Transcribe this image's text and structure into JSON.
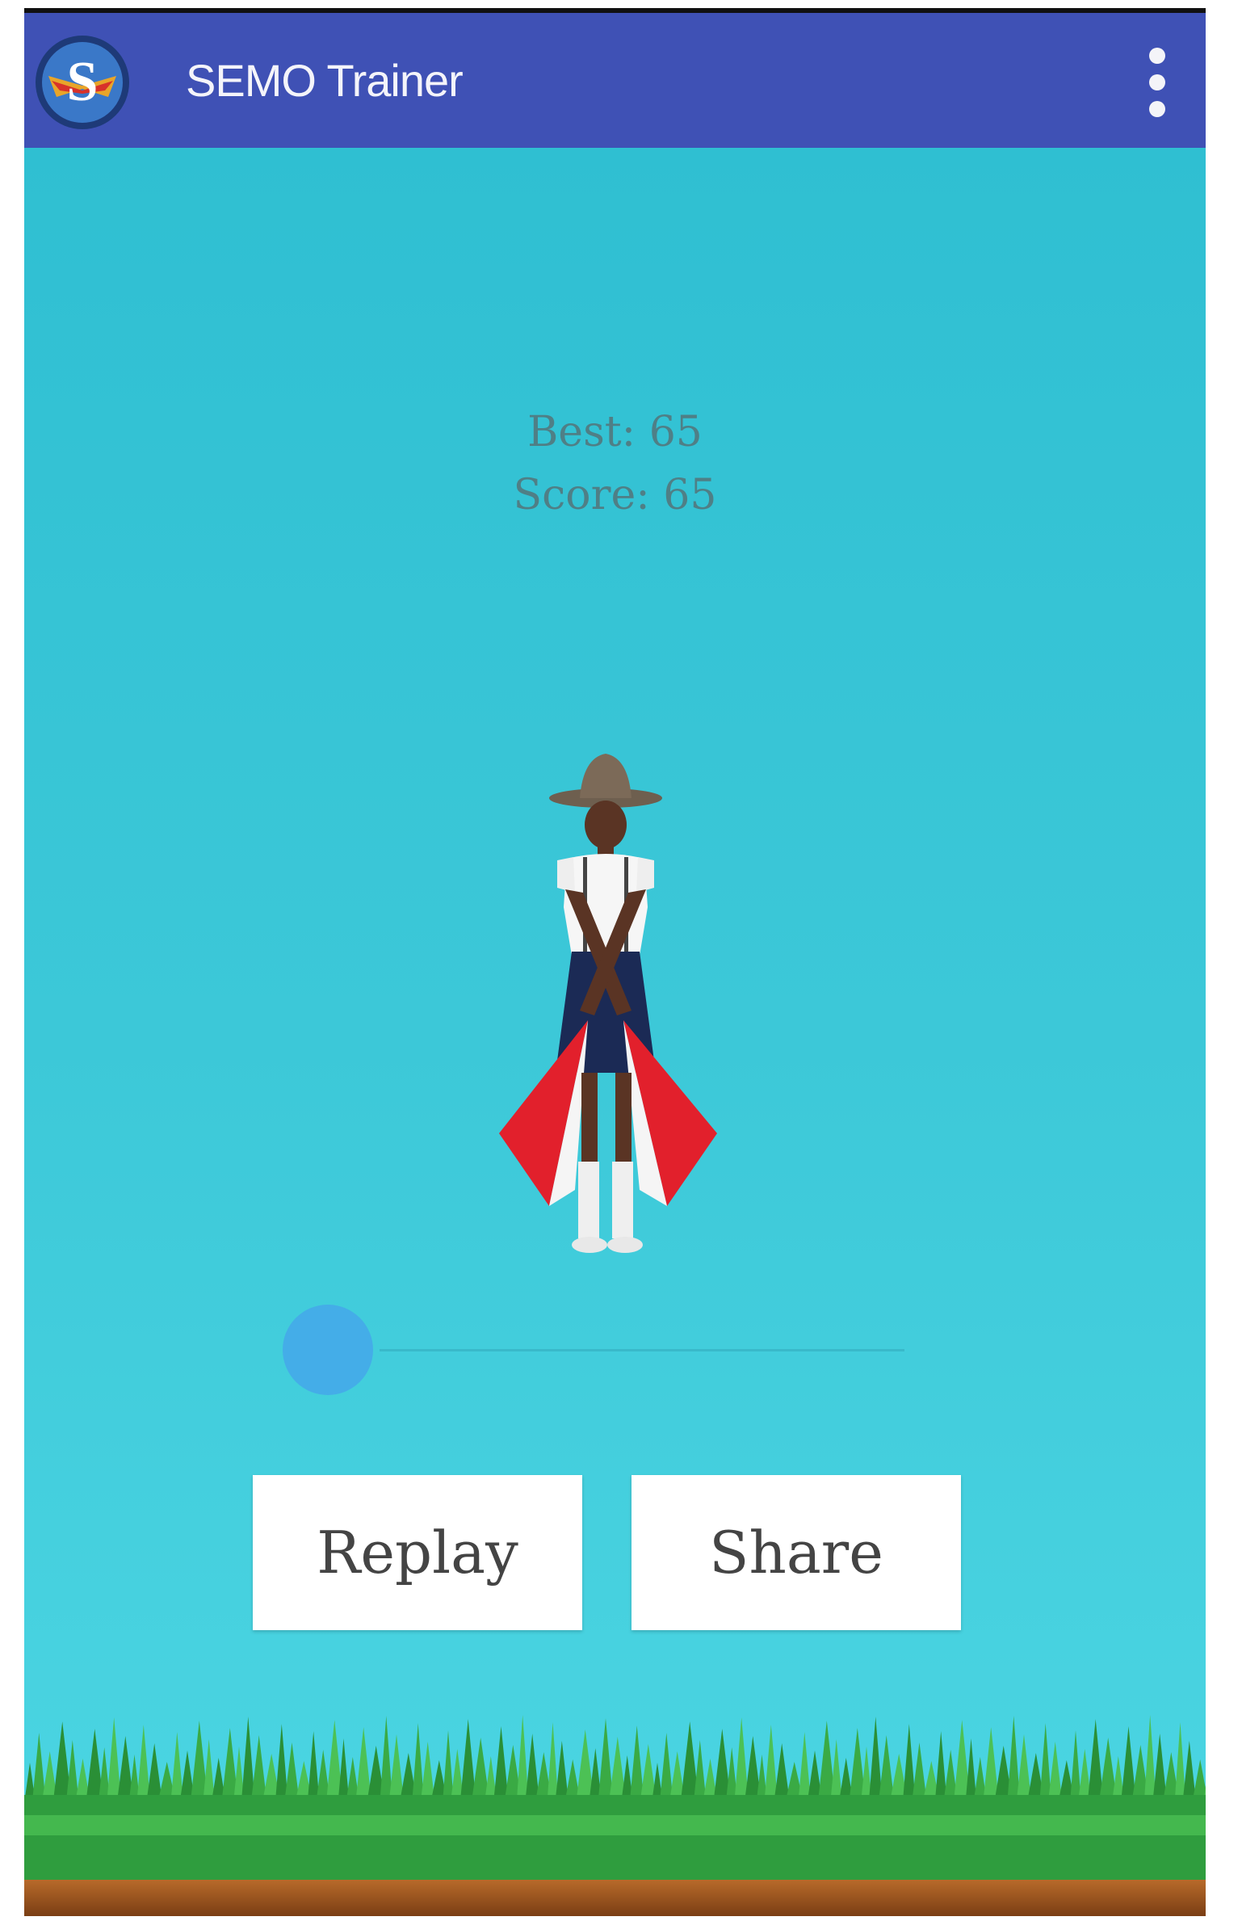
{
  "app_bar": {
    "title": "SEMO Trainer",
    "background_color": "#3f51b5",
    "logo_icon": "semo-logo-icon",
    "menu_icon": "overflow-menu-icon"
  },
  "game": {
    "background_color": "#3cc8d8",
    "best_text": "Best: 65",
    "score_text": "Score: 65",
    "best": 65,
    "score": 65,
    "character": "scout-with-semaphore-flags",
    "slider_value": 0
  },
  "actions": {
    "replay_label": "Replay",
    "share_label": "Share"
  }
}
